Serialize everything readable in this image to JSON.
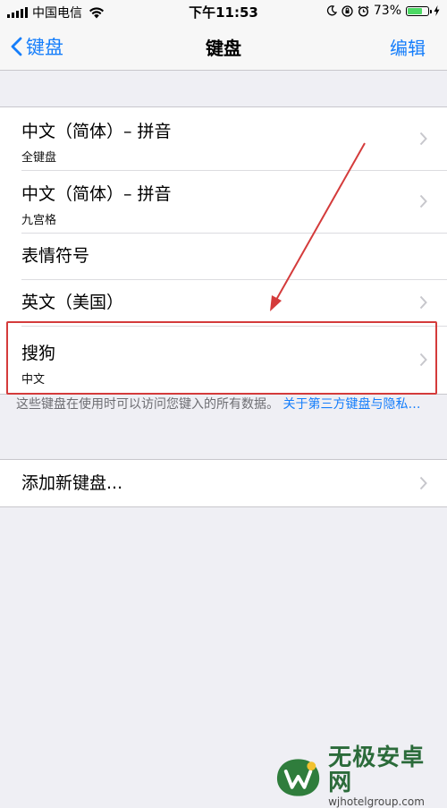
{
  "status_bar": {
    "carrier": "中国电信",
    "time": "下午11:53",
    "battery": "73%",
    "battery_level": 0.73
  },
  "nav": {
    "back_label": "键盘",
    "title": "键盘",
    "edit_label": "编辑"
  },
  "keyboards": [
    {
      "title": "中文（简体）– 拼音",
      "subtitle": "全键盘"
    },
    {
      "title": "中文（简体）– 拼音",
      "subtitle": "九宫格"
    },
    {
      "title": "表情符号"
    },
    {
      "title": "英文（美国）"
    },
    {
      "title": "搜狗",
      "subtitle": "中文"
    }
  ],
  "footer": {
    "note": "这些键盘在使用时可以访问您键入的所有数据。",
    "link": "关于第三方键盘与隐私…"
  },
  "add_keyboard": {
    "label": "添加新键盘..."
  },
  "watermark": {
    "name": "无极安卓网",
    "url": "wjhotelgroup.com"
  },
  "colors": {
    "accent": "#157efb",
    "highlight": "#d43b3b",
    "background": "#efeff4"
  }
}
